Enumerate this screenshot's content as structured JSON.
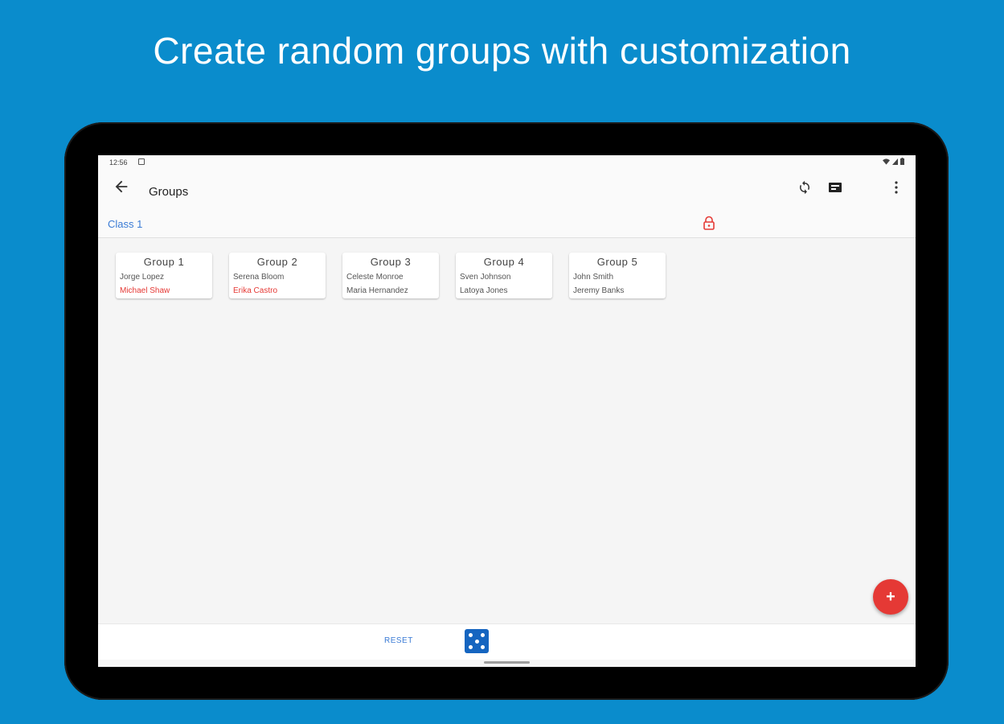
{
  "headline": "Create random groups with customization",
  "statusbar": {
    "time": "12:56"
  },
  "appbar": {
    "title": "Groups",
    "actions": [
      "refresh-icon",
      "slideshow-icon",
      "blank-icon",
      "more-vert-icon"
    ]
  },
  "subbar": {
    "class_name": "Class 1",
    "lock_icon": "lock-icon"
  },
  "groups": [
    {
      "name": "Group 1",
      "members": [
        {
          "name": "Jorge Lopez",
          "locked": false
        },
        {
          "name": "Michael Shaw",
          "locked": true
        }
      ]
    },
    {
      "name": "Group 2",
      "members": [
        {
          "name": "Serena Bloom",
          "locked": false
        },
        {
          "name": "Erika Castro",
          "locked": true
        }
      ]
    },
    {
      "name": "Group 3",
      "members": [
        {
          "name": "Celeste Monroe",
          "locked": false
        },
        {
          "name": "Maria Hernandez",
          "locked": false
        }
      ]
    },
    {
      "name": "Group 4",
      "members": [
        {
          "name": "Sven Johnson",
          "locked": false
        },
        {
          "name": "Latoya Jones",
          "locked": false
        }
      ]
    },
    {
      "name": "Group 5",
      "members": [
        {
          "name": "John Smith",
          "locked": false
        },
        {
          "name": "Jeremy Banks",
          "locked": false
        }
      ]
    }
  ],
  "fab": {
    "label": "+"
  },
  "bottombar": {
    "reset_label": "RESET",
    "dice_icon": "dice-icon"
  },
  "colors": {
    "background": "#0a8ccc",
    "accent": "#3a7bd5",
    "locked": "#e53935",
    "fab": "#e53935",
    "dice": "#1565c0"
  }
}
